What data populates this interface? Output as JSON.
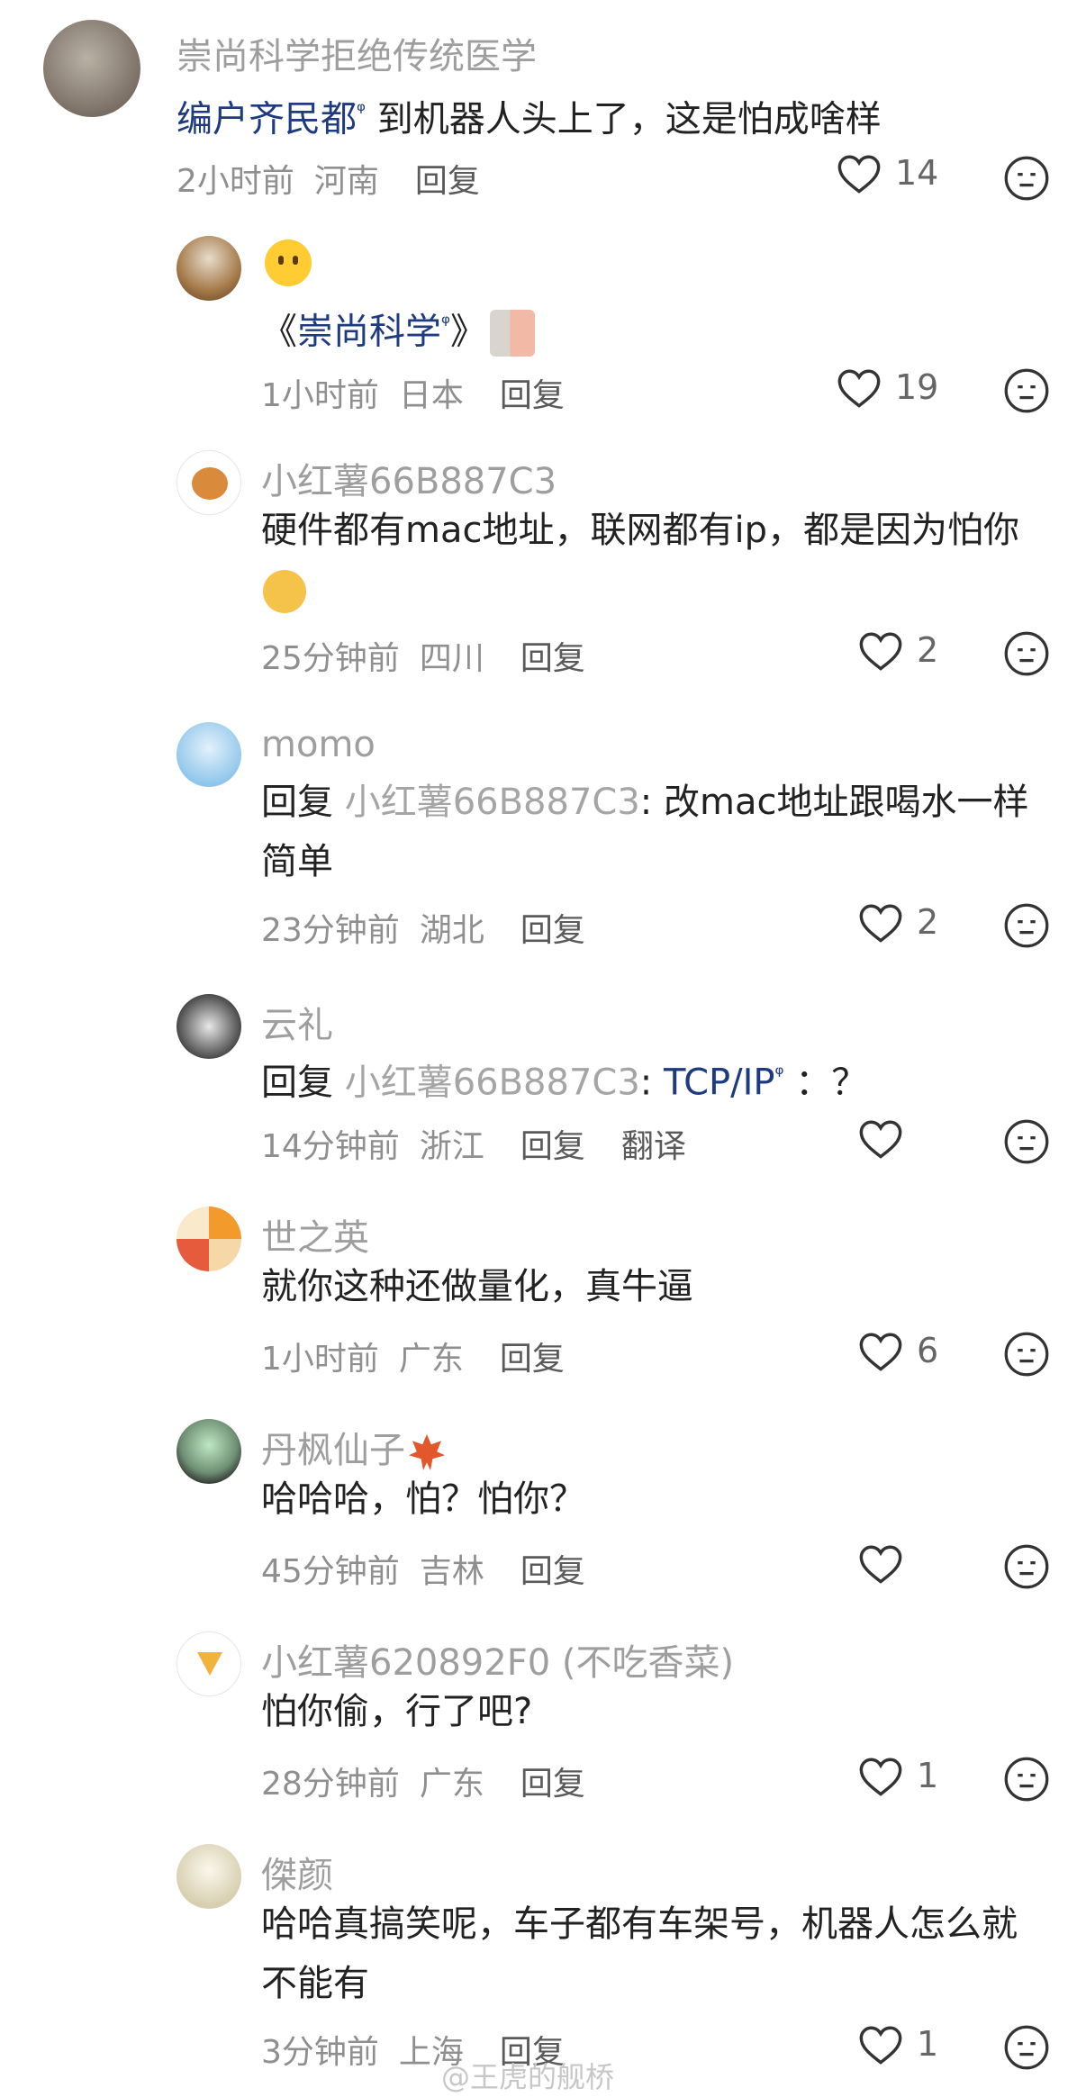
{
  "comments": [
    {
      "user": "崇尚科学拒绝传统医学",
      "text_link": "编户齐民都",
      "text": "到机器人头上了，这是怕成啥样",
      "time": "2小时前",
      "location": "河南",
      "reply": "回复",
      "likes": "14"
    },
    {
      "user": "",
      "text_prefix": "《",
      "text_link": "崇尚科学",
      "text_suffix": "》",
      "time": "1小时前",
      "location": "日本",
      "reply": "回复",
      "likes": "19"
    },
    {
      "user": "小红薯66B887C3",
      "text": "硬件都有mac地址，联网都有ip，都是因为怕你",
      "time": "25分钟前",
      "location": "四川",
      "reply": "回复",
      "likes": "2"
    },
    {
      "user": "momo",
      "reply_prefix": "回复",
      "reply_target": "小红薯66B887C3",
      "text": "改mac地址跟喝水一样简单",
      "time": "23分钟前",
      "location": "湖北",
      "reply": "回复",
      "likes": "2"
    },
    {
      "user": "云礼",
      "reply_prefix": "回复",
      "reply_target": "小红薯66B887C3",
      "text_link": "TCP/IP",
      "text": "：？",
      "time": "14分钟前",
      "location": "浙江",
      "reply": "回复",
      "translate": "翻译",
      "likes": ""
    },
    {
      "user": "世之英",
      "text": "就你这种还做量化，真牛逼",
      "time": "1小时前",
      "location": "广东",
      "reply": "回复",
      "likes": "6"
    },
    {
      "user": "丹枫仙子",
      "text": "哈哈哈，怕？怕你？",
      "time": "45分钟前",
      "location": "吉林",
      "reply": "回复",
      "likes": ""
    },
    {
      "user": "小红薯620892F0 (不吃香菜)",
      "text": "怕你偷，行了吧?",
      "time": "28分钟前",
      "location": "广东",
      "reply": "回复",
      "likes": "1"
    },
    {
      "user": "傑颜",
      "text": "哈哈真搞笑呢，车子都有车架号，机器人怎么就不能有",
      "time": "3分钟前",
      "location": "上海",
      "reply": "回复",
      "likes": "1"
    }
  ],
  "watermark": "@王虎的舰桥",
  "colors": {
    "link": "#1f3b80",
    "meta": "#8f8f8f",
    "username": "#9e9e9e"
  }
}
